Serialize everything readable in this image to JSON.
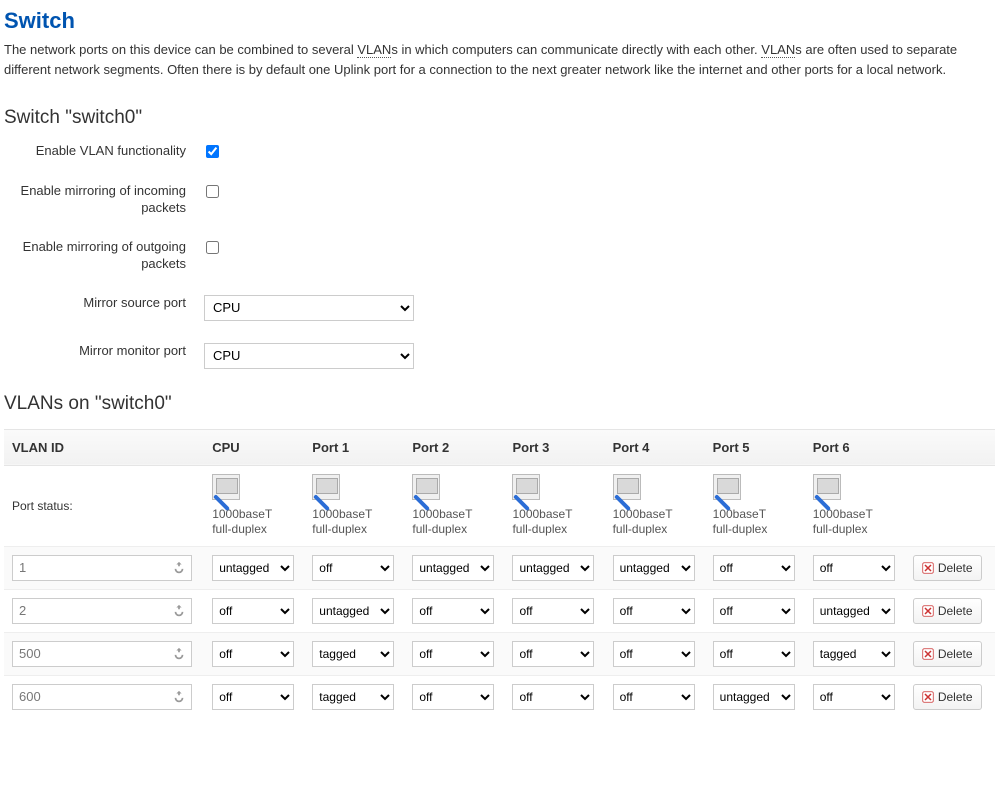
{
  "page": {
    "title": "Switch",
    "description_pre": "The network ports on this device can be combined to several ",
    "vlan_abbr": "VLAN",
    "description_mid": "s in which computers can communicate directly with each other. ",
    "description_post": "s are often used to separate different network segments. Often there is by default one Uplink port for a connection to the next greater network like the internet and other ports for a local network."
  },
  "switch_section": {
    "title": "Switch \"switch0\"",
    "fields": {
      "enable_vlan_label": "Enable VLAN functionality",
      "enable_vlan_checked": true,
      "mirror_in_label": "Enable mirroring of incoming packets",
      "mirror_in_checked": false,
      "mirror_out_label": "Enable mirroring of outgoing packets",
      "mirror_out_checked": false,
      "mirror_src_label": "Mirror source port",
      "mirror_src_value": "CPU",
      "mirror_mon_label": "Mirror monitor port",
      "mirror_mon_value": "CPU"
    }
  },
  "vlan_section": {
    "title": "VLANs on \"switch0\"",
    "columns": [
      "VLAN ID",
      "CPU",
      "Port 1",
      "Port 2",
      "Port 3",
      "Port 4",
      "Port 5",
      "Port 6"
    ],
    "port_status_label": "Port status:",
    "port_status": [
      {
        "speed": "1000baseT",
        "duplex": "full-duplex"
      },
      {
        "speed": "1000baseT",
        "duplex": "full-duplex"
      },
      {
        "speed": "1000baseT",
        "duplex": "full-duplex"
      },
      {
        "speed": "1000baseT",
        "duplex": "full-duplex"
      },
      {
        "speed": "1000baseT",
        "duplex": "full-duplex"
      },
      {
        "speed": "100baseT",
        "duplex": "full-duplex"
      },
      {
        "speed": "1000baseT",
        "duplex": "full-duplex"
      }
    ],
    "tag_options": [
      "untagged",
      "tagged",
      "off"
    ],
    "rows": [
      {
        "id": "1",
        "ports": [
          "untagged",
          "off",
          "untagged",
          "untagged",
          "untagged",
          "off",
          "off"
        ]
      },
      {
        "id": "2",
        "ports": [
          "off",
          "untagged",
          "off",
          "off",
          "off",
          "off",
          "untagged"
        ]
      },
      {
        "id": "500",
        "ports": [
          "off",
          "tagged",
          "off",
          "off",
          "off",
          "off",
          "tagged"
        ]
      },
      {
        "id": "600",
        "ports": [
          "off",
          "tagged",
          "off",
          "off",
          "off",
          "untagged",
          "off"
        ]
      }
    ],
    "delete_label": "Delete"
  }
}
